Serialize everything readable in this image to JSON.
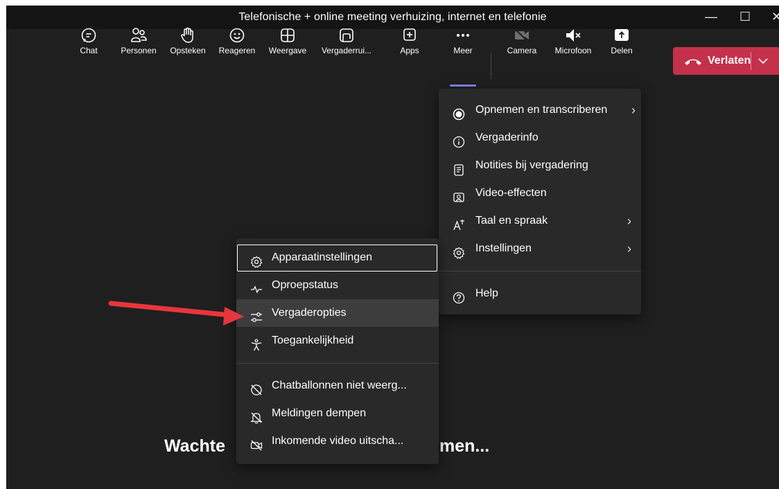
{
  "window": {
    "title": "Telefonische + online meeting verhuizing, internet en telefonie",
    "minimize_glyph": "—",
    "maximize_glyph": "☐",
    "close_glyph": "✕"
  },
  "toolbar": {
    "chat": "Chat",
    "people": "Personen",
    "raise": "Opsteken",
    "react": "Reageren",
    "view": "Weergave",
    "rooms": "Vergaderrui...",
    "apps": "Apps",
    "more": "Meer",
    "camera": "Camera",
    "mic": "Microfoon",
    "share": "Delen",
    "leave": "Verlaten"
  },
  "more_menu": {
    "items": [
      {
        "label": "Opnemen en transcriberen",
        "icon": "record-icon",
        "has_submenu": true
      },
      {
        "label": "Vergaderinfo",
        "icon": "info-icon",
        "has_submenu": false
      },
      {
        "label": "Notities bij vergadering",
        "icon": "notes-icon",
        "has_submenu": false
      },
      {
        "label": "Video-effecten",
        "icon": "video-effects-icon",
        "has_submenu": false
      },
      {
        "label": "Taal en spraak",
        "icon": "language-icon",
        "has_submenu": true
      },
      {
        "label": "Instellingen",
        "icon": "gear-icon",
        "has_submenu": true
      },
      {
        "label": "Help",
        "icon": "help-icon",
        "has_submenu": false
      }
    ]
  },
  "settings_submenu": {
    "items": [
      {
        "label": "Apparaatinstellingen",
        "icon": "gear-icon"
      },
      {
        "label": "Oproepstatus",
        "icon": "pulse-icon"
      },
      {
        "label": "Vergaderopties",
        "icon": "sliders-icon"
      },
      {
        "label": "Toegankelijkheid",
        "icon": "accessibility-icon"
      },
      {
        "label": "Chatballonnen niet weerg...",
        "icon": "chat-bubble-off-icon"
      },
      {
        "label": "Meldingen dempen",
        "icon": "bell-off-icon"
      },
      {
        "label": "Inkomende video uitscha...",
        "icon": "video-off-icon"
      }
    ]
  },
  "stage": {
    "status_left": "Wachte",
    "status_right": "men..."
  },
  "colors": {
    "leave_button": "#c4314b",
    "accent": "#7f85f5",
    "arrow": "#e8353d",
    "background": "#1f1f1f",
    "menu": "#292929"
  }
}
